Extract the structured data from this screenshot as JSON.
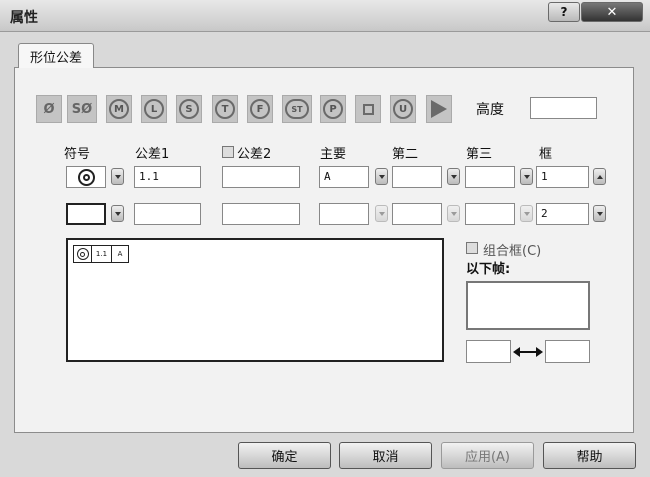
{
  "window": {
    "title": "属性",
    "help_label": "?",
    "close_label": "✕"
  },
  "tab": {
    "label": "形位公差"
  },
  "toolbar": {
    "symbols": [
      {
        "name": "diameter",
        "text": "Ø"
      },
      {
        "name": "spherical-diameter",
        "text": "SØ"
      },
      {
        "name": "mmc",
        "text": "M"
      },
      {
        "name": "lmc",
        "text": "L"
      },
      {
        "name": "rfs",
        "text": "S"
      },
      {
        "name": "tangent-plane",
        "text": "T"
      },
      {
        "name": "free-state",
        "text": "F"
      },
      {
        "name": "statistical",
        "text": "ST"
      },
      {
        "name": "projected",
        "text": "P"
      },
      {
        "name": "square",
        "text": ""
      },
      {
        "name": "unequal",
        "text": "U"
      },
      {
        "name": "triangle",
        "text": ""
      }
    ],
    "height_label": "高度",
    "height_value": ""
  },
  "columns": {
    "symbol": "符号",
    "tol1": "公差1",
    "tol2": "公差2",
    "primary": "主要",
    "secondary": "第二",
    "tertiary": "第三",
    "frame": "框"
  },
  "row1": {
    "tol1": "1.1",
    "tol2": "",
    "primary": "A",
    "secondary": "",
    "tertiary": "",
    "frame": "1"
  },
  "row2": {
    "tol1": "",
    "tol2": "",
    "primary": "",
    "secondary": "",
    "tertiary": "",
    "frame": "2"
  },
  "preview": {
    "tol": "1.1",
    "datum": "A"
  },
  "composite": {
    "label": "组合框(C)",
    "below_label": "以下帧:"
  },
  "buttons": {
    "ok": "确定",
    "cancel": "取消",
    "apply": "应用(A)",
    "help": "帮助"
  },
  "colors": {
    "chrome": "#d9d9d9",
    "panel": "#f2f2f2",
    "close_button": "#333333"
  }
}
